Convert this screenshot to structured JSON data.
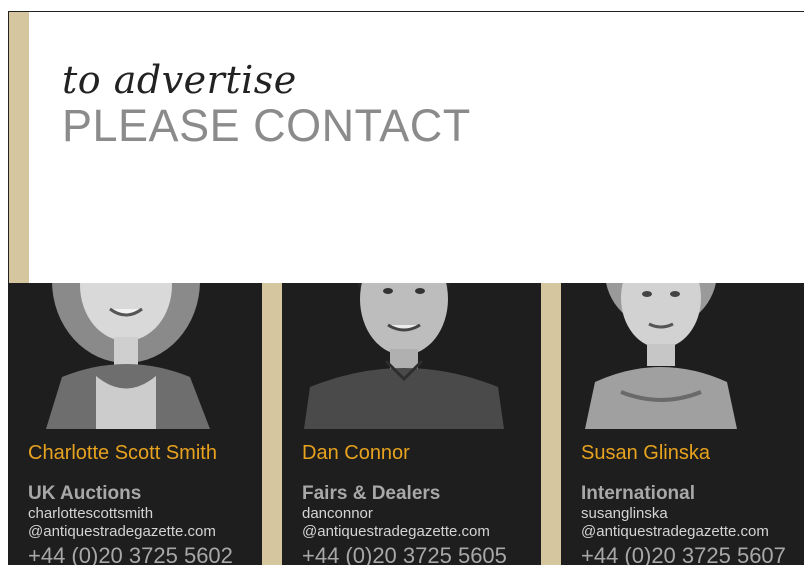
{
  "headline": {
    "line1": "to advertise",
    "line2": "PLEASE CONTACT"
  },
  "colors": {
    "accent_gold": "#d6c6a0",
    "name_orange": "#e7a21e",
    "panel_dark": "#1e1e1e"
  },
  "contacts": [
    {
      "name": "Charlotte Scott Smith",
      "department": "UK Auctions",
      "email_line1": "charlottescottsmith",
      "email_line2": "@antiquestradegazette.com",
      "phone": "+44 (0)20 3725 5602",
      "photo": "portrait-photo"
    },
    {
      "name": "Dan Connor",
      "department": "Fairs & Dealers",
      "email_line1": "danconnor",
      "email_line2": "@antiquestradegazette.com",
      "phone": "+44 (0)20 3725 5605",
      "photo": "portrait-photo"
    },
    {
      "name": "Susan Glinska",
      "department": "International",
      "email_line1": "susanglinska",
      "email_line2": "@antiquestradegazette.com",
      "phone": "+44 (0)20 3725 5607",
      "photo": "portrait-photo"
    }
  ]
}
